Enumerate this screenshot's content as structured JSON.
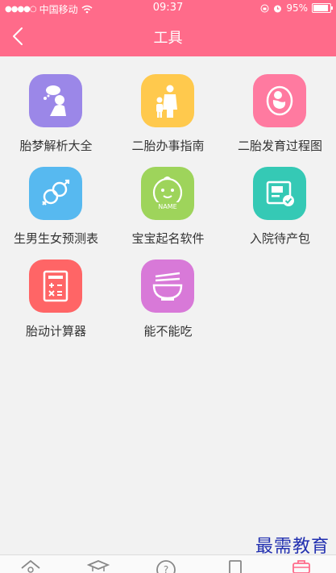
{
  "status_bar": {
    "carrier": "中国移动",
    "time": "09:37",
    "battery": "95%"
  },
  "nav": {
    "title": "工具"
  },
  "tools": [
    {
      "label": "胎梦解析大全",
      "icon": "dream-icon",
      "color": "#9b87e8"
    },
    {
      "label": "二胎办事指南",
      "icon": "family-icon",
      "color": "#ffc94d"
    },
    {
      "label": "二胎发育过程图",
      "icon": "fetus-icon",
      "color": "#ff7aa0"
    },
    {
      "label": "生男生女预测表",
      "icon": "gender-icon",
      "color": "#57b9f0"
    },
    {
      "label": "宝宝起名软件",
      "icon": "baby-name-icon",
      "color": "#9ed45b"
    },
    {
      "label": "入院待产包",
      "icon": "checklist-icon",
      "color": "#35c9b5"
    },
    {
      "label": "胎动计算器",
      "icon": "calculator-icon",
      "color": "#ff6566"
    },
    {
      "label": "能不能吃",
      "icon": "bowl-icon",
      "color": "#d879d8"
    }
  ],
  "tabbar": {
    "icons": [
      "home-icon",
      "school-icon",
      "help-icon",
      "book-icon",
      "toolbox-icon"
    ]
  },
  "watermark": "最需教育"
}
